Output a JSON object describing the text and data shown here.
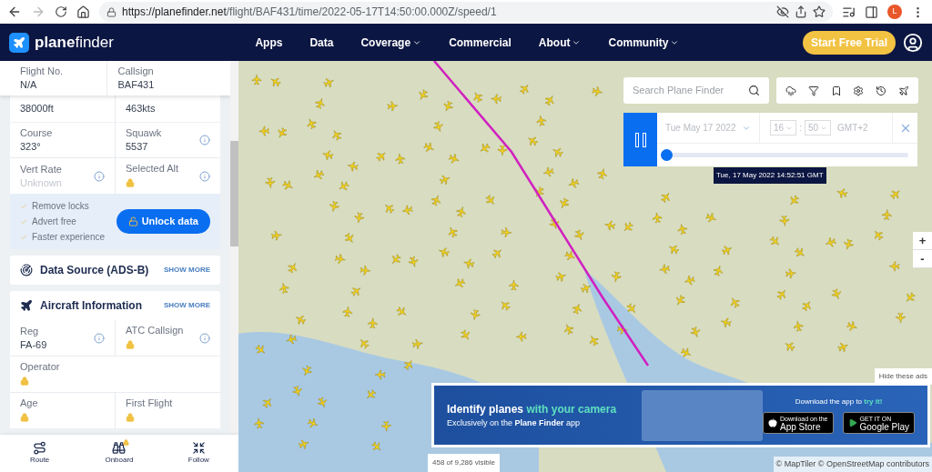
{
  "browser": {
    "url_host": "https://planefinder.net",
    "url_path": "/flight/BAF431/time/2022-05-17T14:50:00.000Z/speed/1",
    "profile": "L"
  },
  "nav": {
    "brand": "**plane**finder",
    "items": [
      {
        "label": "Apps",
        "dropdown": false
      },
      {
        "label": "Data",
        "dropdown": false
      },
      {
        "label": "Coverage",
        "dropdown": true
      },
      {
        "label": "Commercial",
        "dropdown": false
      },
      {
        "label": "About",
        "dropdown": true
      },
      {
        "label": "Community",
        "dropdown": true
      }
    ],
    "cta": "Start Free Trial"
  },
  "sidebar": {
    "header_fields": [
      {
        "label": "Flight No.",
        "value": "N/A"
      },
      {
        "label": "Callsign",
        "value": "BAF431"
      }
    ],
    "partial_values": [
      "38000ft",
      "463kts"
    ],
    "flight_rows": [
      [
        {
          "label": "Course",
          "kind": "text",
          "value": "323°",
          "info": false
        },
        {
          "label": "Squawk",
          "kind": "text",
          "value": "5537",
          "info": true
        }
      ],
      [
        {
          "label": "Vert Rate",
          "kind": "muted",
          "value": "Unknown",
          "info": true
        },
        {
          "label": "Selected Alt",
          "kind": "locked",
          "info": true
        }
      ]
    ],
    "unlock": {
      "perks": [
        "Remove locks",
        "Advert free",
        "Faster experience"
      ],
      "button": "Unlock data"
    },
    "sections": [
      {
        "title": "Data Source (ADS-B)",
        "action": "SHOW MORE"
      },
      {
        "title": "Aircraft Information",
        "action": "SHOW MORE",
        "rows": [
          [
            {
              "label": "Reg",
              "kind": "text",
              "value": "FA-69",
              "info": true
            },
            {
              "label": "ATC Callsign",
              "kind": "locked",
              "info": true
            }
          ],
          [
            {
              "label": "Operator",
              "kind": "locked",
              "info": false
            }
          ],
          [
            {
              "label": "Age",
              "kind": "locked",
              "info": false
            },
            {
              "label": "First Flight",
              "kind": "locked",
              "info": false
            }
          ]
        ]
      }
    ],
    "bottom_actions": [
      {
        "label": "Route",
        "locked": false
      },
      {
        "label": "Onboard",
        "locked": true
      },
      {
        "label": "Follow",
        "locked": false
      }
    ]
  },
  "map": {
    "search_placeholder": "Search Plane Finder",
    "playback": {
      "playing": true,
      "date": "Tue May 17 2022",
      "hour": "16",
      "separator": ":",
      "minute": "50",
      "timezone": "GMT+2",
      "level": 0,
      "tooltip": "Tue, 17 May 2022 14:52:51 GMT"
    },
    "zoom": [
      "+",
      "-"
    ],
    "hide_ads": "Hide these ads",
    "ad": {
      "headline": "Identify planes",
      "headline_highlight": "with your camera",
      "subline": "Exclusively on the **Plane Finder** app",
      "download": "Download the app to",
      "download_highlight": "try it!",
      "stores": [
        {
          "kind": "apple",
          "small": "Download on the",
          "big": "App Store"
        },
        {
          "kind": "google",
          "small": "GET IT ON",
          "big": "Google Play"
        }
      ]
    },
    "visible_count": "458 of 9,286 visible",
    "attribution": "© MapTiler © OpenStreetMap contributors"
  }
}
